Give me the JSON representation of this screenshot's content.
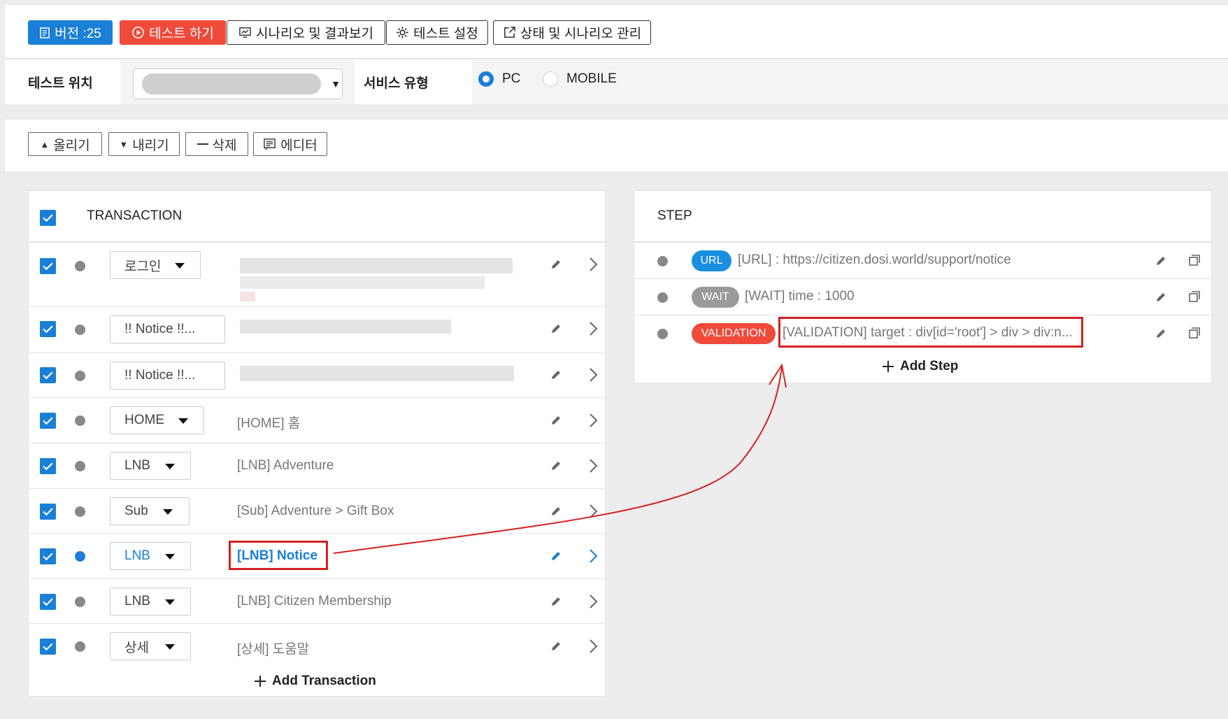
{
  "toolbar": {
    "version_label": "버전 :25",
    "test_label": "테스트 하기",
    "scenario_label": "시나리오 및 결과보기",
    "settings_label": "테스트 설정",
    "manage_label": "상태 및 시나리오 관리"
  },
  "location": {
    "label": "테스트 위치",
    "service_label": "서비스 유형",
    "options": [
      "PC",
      "MOBILE"
    ],
    "selected": "PC"
  },
  "actions": {
    "up": "올리기",
    "down": "내리기",
    "delete": "삭제",
    "editor": "에디터"
  },
  "transaction": {
    "header": "TRANSACTION",
    "rows": [
      {
        "tag": "로그인",
        "name": ""
      },
      {
        "tag": "!! Notice !!...",
        "name": ""
      },
      {
        "tag": "!! Notice !!...",
        "name": ""
      },
      {
        "tag": "HOME",
        "name": "[HOME] 홈"
      },
      {
        "tag": "LNB",
        "name": "[LNB] Adventure"
      },
      {
        "tag": "Sub",
        "name": "[Sub] Adventure > Gift Box"
      },
      {
        "tag": "LNB",
        "name": "[LNB] Notice"
      },
      {
        "tag": "LNB",
        "name": "[LNB] Citizen Membership"
      },
      {
        "tag": "상세",
        "name": "[상세] 도움말"
      }
    ],
    "add_label": "Add Transaction"
  },
  "step": {
    "header": "STEP",
    "rows": [
      {
        "type": "URL",
        "text": "[URL] : https://citizen.dosi.world/support/notice",
        "color": "#1a8fe0"
      },
      {
        "type": "WAIT",
        "text": "[WAIT] time : 1000",
        "color": "#9a9a9a"
      },
      {
        "type": "VALIDATION",
        "text": "[VALIDATION] target : div[id='root'] > div > div:n...",
        "color": "#f04a3a"
      }
    ],
    "add_label": "Add Step"
  },
  "colors": {
    "accent": "#1a7fd6",
    "danger": "#f04a3a",
    "annotation": "#d62020"
  }
}
